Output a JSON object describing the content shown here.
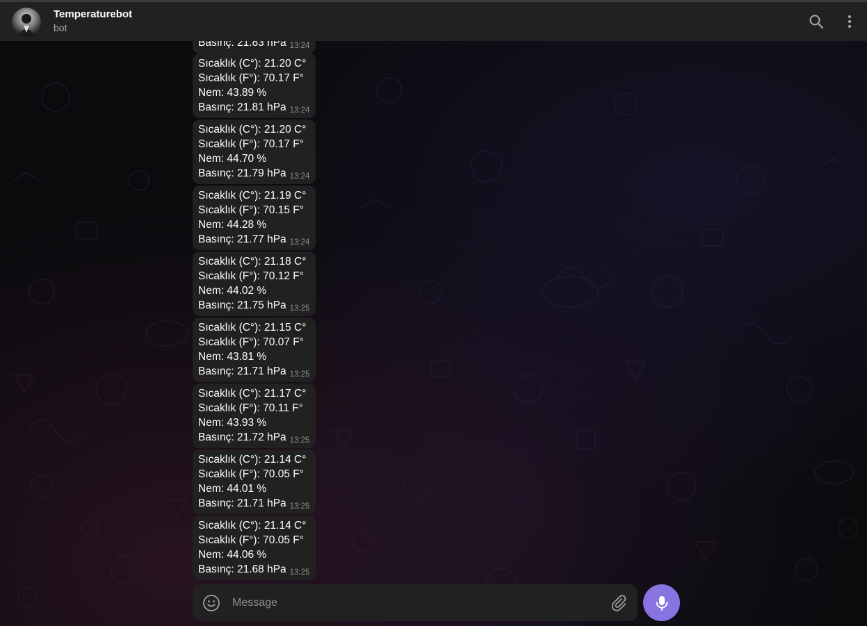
{
  "header": {
    "title": "Temperaturebot",
    "subtitle": "bot",
    "avatar_icon": "user-avatar-icon",
    "search_icon": "search-icon",
    "more_icon": "more-vertical-icon"
  },
  "messages": [
    {
      "lines": [
        "Basınç: 21.83 hPa"
      ],
      "time": "13:24"
    },
    {
      "lines": [
        "Sıcaklık (C°): 21.20 C°",
        "Sıcaklık (F°): 70.17 F°",
        "Nem: 43.89 %",
        "Basınç: 21.81 hPa"
      ],
      "time": "13:24"
    },
    {
      "lines": [
        "Sıcaklık (C°): 21.20 C°",
        "Sıcaklık (F°): 70.17 F°",
        "Nem: 44.70 %",
        "Basınç: 21.79 hPa"
      ],
      "time": "13:24"
    },
    {
      "lines": [
        "Sıcaklık (C°): 21.19 C°",
        "Sıcaklık (F°): 70.15 F°",
        "Nem: 44.28 %",
        "Basınç: 21.77 hPa"
      ],
      "time": "13:24"
    },
    {
      "lines": [
        "Sıcaklık (C°): 21.18 C°",
        "Sıcaklık (F°): 70.12 F°",
        "Nem: 44.02 %",
        "Basınç: 21.75 hPa"
      ],
      "time": "13:25"
    },
    {
      "lines": [
        "Sıcaklık (C°): 21.15 C°",
        "Sıcaklık (F°): 70.07 F°",
        "Nem: 43.81 %",
        "Basınç: 21.71 hPa"
      ],
      "time": "13:25"
    },
    {
      "lines": [
        "Sıcaklık (C°): 21.17 C°",
        "Sıcaklık (F°): 70.11 F°",
        "Nem: 43.93 %",
        "Basınç: 21.72 hPa"
      ],
      "time": "13:25"
    },
    {
      "lines": [
        "Sıcaklık (C°): 21.14 C°",
        "Sıcaklık (F°): 70.05 F°",
        "Nem: 44.01 %",
        "Basınç: 21.71 hPa"
      ],
      "time": "13:25"
    },
    {
      "lines": [
        "Sıcaklık (C°): 21.14 C°",
        "Sıcaklık (F°): 70.05 F°",
        "Nem: 44.06 %",
        "Basınç: 21.68 hPa"
      ],
      "time": "13:25"
    }
  ],
  "composer": {
    "placeholder": "Message",
    "value": "",
    "emoji_icon": "smile-icon",
    "attach_icon": "paperclip-icon",
    "mic_icon": "microphone-icon"
  },
  "colors": {
    "header_bg": "#212121",
    "bubble_bg": "#212121",
    "accent": "#8774e1",
    "timestamp": "#8f8f8f"
  }
}
